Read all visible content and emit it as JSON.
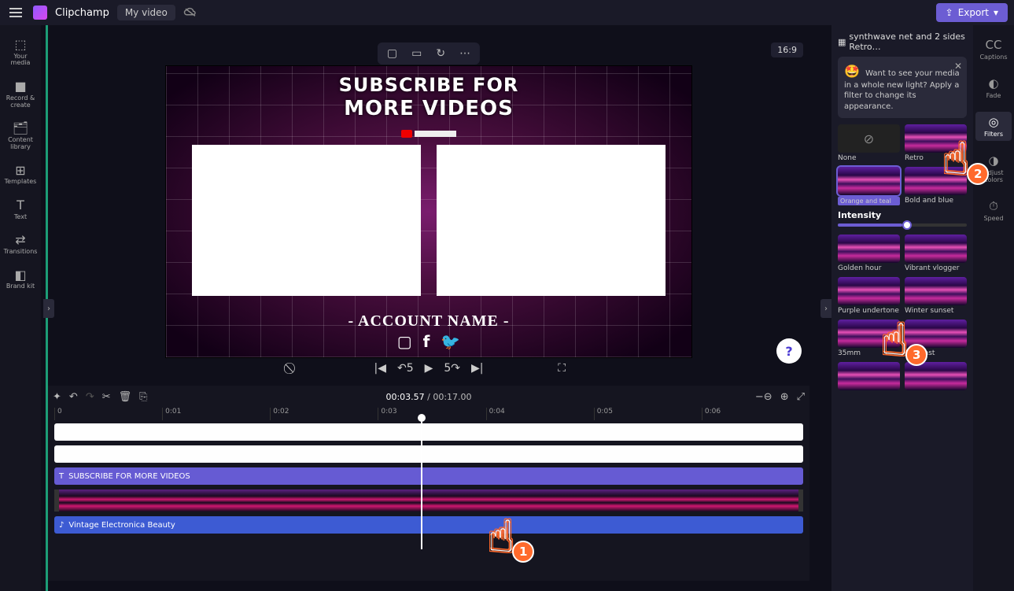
{
  "topbar": {
    "app_name": "Clipchamp",
    "project_name": "My video",
    "export_label": "Export"
  },
  "sidebar": {
    "items": [
      {
        "icon": "⬚",
        "label": "Your media"
      },
      {
        "icon": "●REC",
        "label": "Record & create"
      },
      {
        "icon": "🗂",
        "label": "Content library"
      },
      {
        "icon": "⊞",
        "label": "Templates"
      },
      {
        "icon": "T",
        "label": "Text"
      },
      {
        "icon": "⇄",
        "label": "Transitions"
      },
      {
        "icon": "◧",
        "label": "Brand kit"
      }
    ]
  },
  "canvas": {
    "title_l1": "SUBSCRIBE FOR",
    "title_l2": "MORE VIDEOS",
    "account": "- ACCOUNT NAME -",
    "aspect": "16:9"
  },
  "playbar": {
    "current": "00:03.57",
    "total": "00:17.00"
  },
  "ruler": [
    "0",
    "0:01",
    "0:02",
    "0:03",
    "0:04",
    "0:05",
    "0:06"
  ],
  "tracks": {
    "text_clip": "SUBSCRIBE FOR MORE VIDEOS",
    "audio_clip": "Vintage Electronica Beauty"
  },
  "rpanel": {
    "clip_name": "synthwave net and 2 sides Retro…",
    "tip": "Want to see your media in a whole new light? Apply a filter to change its appearance.",
    "intensity_label": "Intensity",
    "filters": [
      {
        "label": "None",
        "none": true
      },
      {
        "label": "Retro"
      },
      {
        "label": "Orange and teal",
        "selected": true
      },
      {
        "label": "Bold and blue"
      },
      {
        "label": "Golden hour"
      },
      {
        "label": "Vibrant vlogger"
      },
      {
        "label": "Purple undertone"
      },
      {
        "label": "Winter sunset"
      },
      {
        "label": "35mm"
      },
      {
        "label": "Contrast"
      }
    ]
  },
  "rtabs": [
    {
      "icon": "CC",
      "label": "Captions"
    },
    {
      "icon": "◐",
      "label": "Fade"
    },
    {
      "icon": "◎",
      "label": "Filters",
      "active": true
    },
    {
      "icon": "◑",
      "label": "Adjust colors"
    },
    {
      "icon": "⏱",
      "label": "Speed"
    }
  ],
  "annotations": [
    {
      "num": "1"
    },
    {
      "num": "2"
    },
    {
      "num": "3"
    }
  ]
}
